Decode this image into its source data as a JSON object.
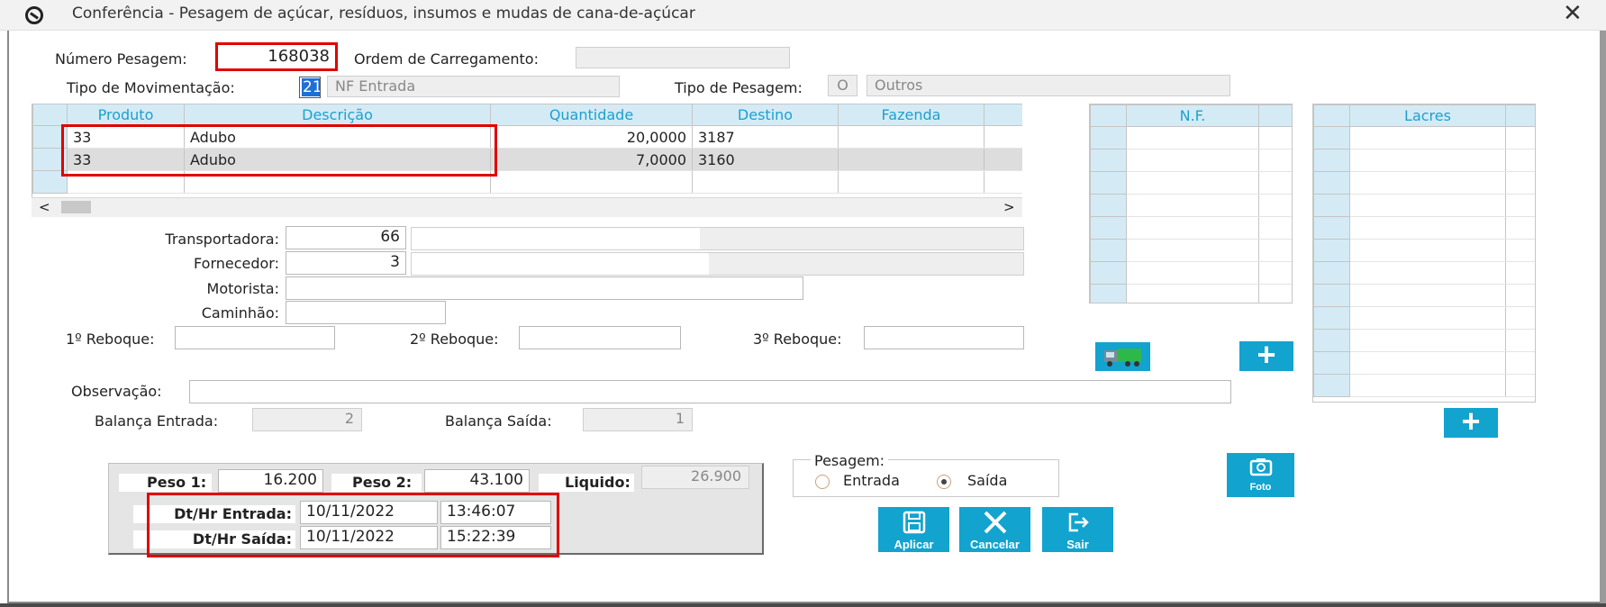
{
  "window": {
    "title": "Conferência - Pesagem de açúcar, resíduos, insumos e mudas de cana-de-açúcar",
    "close_glyph": "✕"
  },
  "header": {
    "numero_pesagem_label": "Número Pesagem:",
    "numero_pesagem_value": "168038",
    "ordem_carregamento_label": "Ordem de Carregamento:",
    "ordem_carregamento_value": "",
    "tipo_movimentacao_label": "Tipo de Movimentação:",
    "tipo_movimentacao_code": "21",
    "tipo_movimentacao_desc": "NF Entrada",
    "tipo_pesagem_label": "Tipo de Pesagem:",
    "tipo_pesagem_code": "O",
    "tipo_pesagem_desc": "Outros"
  },
  "products_grid": {
    "columns": [
      "Produto",
      "Descrição",
      "Quantidade",
      "Destino",
      "Fazenda"
    ],
    "rows": [
      {
        "produto": "33",
        "descricao": "Adubo",
        "quantidade": "20,0000",
        "destino": "3187",
        "fazenda": ""
      },
      {
        "produto": "33",
        "descricao": "Adubo",
        "quantidade": "7,0000",
        "destino": "3160",
        "fazenda": ""
      }
    ],
    "scroll_left": "<",
    "scroll_right": ">"
  },
  "nf_grid": {
    "column": "N.F."
  },
  "lacres_grid": {
    "column": "Lacres"
  },
  "vehicle": {
    "transportadora_label": "Transportadora:",
    "transportadora_code": "66",
    "fornecedor_label": "Fornecedor:",
    "fornecedor_code": "3",
    "motorista_label": "Motorista:",
    "caminhao_label": "Caminhão:",
    "reboque1_label": "1º Reboque:",
    "reboque2_label": "2º Reboque:",
    "reboque3_label": "3º Reboque:"
  },
  "observacao_label": "Observação:",
  "balanca": {
    "entrada_label": "Balança Entrada:",
    "entrada_value": "2",
    "saida_label": "Balança Saída:",
    "saida_value": "1"
  },
  "weights": {
    "peso1_label": "Peso 1:",
    "peso1_value": "16.200",
    "peso2_label": "Peso 2:",
    "peso2_value": "43.100",
    "liquido_label": "Liquido:",
    "liquido_value": "26.900",
    "dt_entrada_label": "Dt/Hr Entrada:",
    "dt_entrada_date": "10/11/2022",
    "dt_entrada_time": "13:46:07",
    "dt_saida_label": "Dt/Hr Saída:",
    "dt_saida_date": "10/11/2022",
    "dt_saida_time": "15:22:39"
  },
  "pesagem_group": {
    "legend": "Pesagem:",
    "entrada_label": "Entrada",
    "saida_label": "Saída",
    "selected": "Saída"
  },
  "buttons": {
    "foto": "Foto",
    "aplicar": "Aplicar",
    "cancelar": "Cancelar",
    "sair": "Sair",
    "add_glyph": "+"
  },
  "colors": {
    "accent_blue": "#12a3cf",
    "grid_header_bg": "#d4ebf5",
    "grid_header_text": "#1da0d0",
    "highlight_red": "#e00000"
  }
}
